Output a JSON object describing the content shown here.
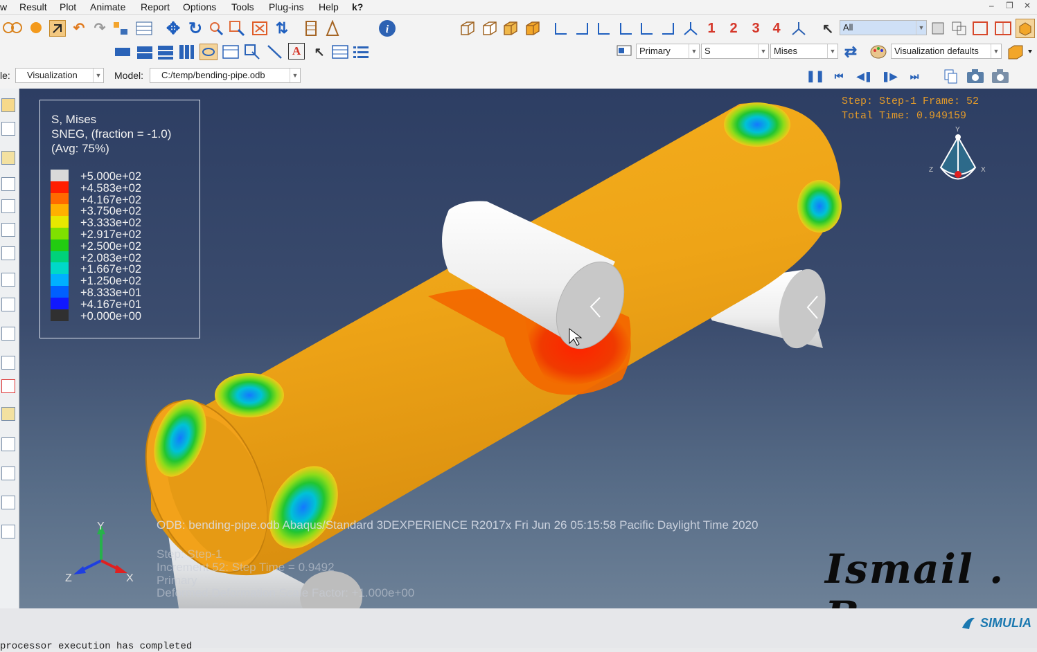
{
  "menu": [
    "Result",
    "Plot",
    "Animate",
    "Report",
    "Options",
    "Tools",
    "Plug-ins",
    "Help"
  ],
  "menu_help_cursor": "k?",
  "menu_left_fragment": "w",
  "toolbar": {
    "view_numbers": [
      "1",
      "2",
      "3",
      "4"
    ],
    "selection_filter": "All",
    "field_output": {
      "primary": "Primary",
      "variable": "S",
      "invariant": "Mises"
    },
    "visualization_defaults": "Visualization defaults"
  },
  "context": {
    "module_label": "le:",
    "module_value": "Visualization",
    "model_label": "Model:",
    "model_value": "C:/temp/bending-pipe.odb"
  },
  "legend": {
    "title_lines": [
      "S, Mises",
      "SNEG, (fraction = -1.0)",
      "(Avg: 75%)"
    ],
    "values": [
      "+5.000e+02",
      "+4.583e+02",
      "+4.167e+02",
      "+3.750e+02",
      "+3.333e+02",
      "+2.917e+02",
      "+2.500e+02",
      "+2.083e+02",
      "+1.667e+02",
      "+1.250e+02",
      "+8.333e+01",
      "+4.167e+01",
      "+0.000e+00"
    ],
    "colors": [
      "#d9d9d9",
      "#ff1e00",
      "#ff6a00",
      "#ffb000",
      "#e8e800",
      "#7fe000",
      "#22cc11",
      "#00d27a",
      "#00d8c8",
      "#00b0ff",
      "#0060ff",
      "#1018ff",
      "#303030"
    ]
  },
  "step_info": {
    "step_line": "Step: Step-1   Frame: 52",
    "time_line": "Total Time: 0.949159"
  },
  "footer": {
    "odb_line": "ODB: bending-pipe.odb    Abaqus/Standard 3DEXPERIENCE R2017x    Fri Jun 26 05:15:58 Pacific Daylight Time 2020",
    "step_line": "Step: Step-1",
    "increment_line": "Increment    52: Step Time =    0.9492",
    "primary_line": "Primary",
    "deformed_line": "Deformed    Deformation Scale Factor: +1.000e+00"
  },
  "triad_labels": {
    "y": "Y",
    "z": "Z",
    "x": "X"
  },
  "mini_triad_labels": {
    "y": "Y",
    "z": "Z",
    "x": "X"
  },
  "signature": "Ismail . B",
  "brand": "SIMULIA",
  "message": "processor execution has completed"
}
